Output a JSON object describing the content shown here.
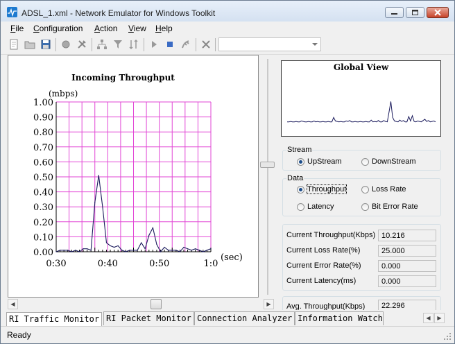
{
  "window": {
    "title": "ADSL_1.xml - Network Emulator for Windows Toolkit",
    "accent": "#1e7ad0"
  },
  "menu": [
    {
      "label": "File",
      "accel": "F",
      "rest": "ile"
    },
    {
      "label": "Configuration",
      "accel": "C",
      "rest": "onfiguration"
    },
    {
      "label": "Action",
      "accel": "A",
      "rest": "ction"
    },
    {
      "label": "View",
      "accel": "V",
      "rest": "iew"
    },
    {
      "label": "Help",
      "accel": "H",
      "rest": "elp"
    }
  ],
  "toolbar": {
    "icons": [
      "new-file-icon",
      "open-folder-icon",
      "save-disk-icon",
      "record-icon",
      "tools-icon",
      "network-icon",
      "filter-icon",
      "sort-icon",
      "play-icon",
      "stop-icon",
      "capture-icon",
      "disconnect-icon"
    ],
    "combo_value": ""
  },
  "chart_data": {
    "type": "line",
    "title": "Incoming Throughput",
    "ylabel": "(mbps)",
    "xlabel": "(sec)",
    "ylim": [
      0,
      1.0
    ],
    "y_ticks": [
      "0.00",
      "0.10",
      "0.20",
      "0.30",
      "0.40",
      "0.50",
      "0.60",
      "0.70",
      "0.80",
      "0.90",
      "1.00"
    ],
    "x_ticks": [
      "0:30",
      "0:40",
      "0:50",
      "1:0"
    ],
    "grid": true,
    "grid_color": "#e246d6",
    "line_color": "#1a1a5c",
    "series": [
      {
        "values": [
          0.0,
          0.01,
          0.01,
          0.01,
          0.0,
          0.01,
          0.0,
          0.02,
          0.02,
          0.01,
          0.33,
          0.51,
          0.3,
          0.06,
          0.04,
          0.03,
          0.04,
          0.01,
          0.0,
          0.01,
          0.01,
          0.01,
          0.06,
          0.02,
          0.11,
          0.16,
          0.05,
          0.0,
          0.03,
          0.01,
          0.01,
          0.01,
          0.0,
          0.03,
          0.02,
          0.01,
          0.02,
          0.01,
          0.0,
          0.01,
          0.02
        ]
      }
    ]
  },
  "global_view": {
    "title": "Global View",
    "series": [
      0.02,
      0.02,
      0.03,
      0.02,
      0.02,
      0.03,
      0.02,
      0.02,
      0.04,
      0.03,
      0.02,
      0.02,
      0.03,
      0.02,
      0.02,
      0.04,
      0.02,
      0.03,
      0.02,
      0.02,
      0.03,
      0.02,
      0.02,
      0.03,
      0.02,
      0.02,
      0.12,
      0.04,
      0.03,
      0.02,
      0.03,
      0.02,
      0.02,
      0.04,
      0.03,
      0.05,
      0.02,
      0.02,
      0.03,
      0.02,
      0.02,
      0.03,
      0.02,
      0.02,
      0.03,
      0.02,
      0.02,
      0.06,
      0.02,
      0.03,
      0.02,
      0.05,
      0.02,
      0.02,
      0.05,
      0.03,
      0.02,
      0.25,
      0.48,
      0.12,
      0.04,
      0.03,
      0.02,
      0.06,
      0.03,
      0.05,
      0.02,
      0.02,
      0.14,
      0.04,
      0.16,
      0.03,
      0.02,
      0.04,
      0.03,
      0.02,
      0.05,
      0.08,
      0.03,
      0.05,
      0.02,
      0.03,
      0.04,
      0.02
    ]
  },
  "stream": {
    "title": "Stream",
    "options": [
      "UpStream",
      "DownStream"
    ],
    "selected": "UpStream"
  },
  "data_group": {
    "title": "Data",
    "options": [
      "Throughput",
      "Loss Rate",
      "Latency",
      "Bit Error Rate"
    ],
    "selected": "Throughput"
  },
  "stats": [
    {
      "label": "Current Throughput(Kbps)",
      "value": "10.216"
    },
    {
      "label": "Current Loss Rate(%)",
      "value": "25.000"
    },
    {
      "label": "Current Error Rate(%)",
      "value": "0.000"
    },
    {
      "label": "Current Latency(ms)",
      "value": "0.000"
    }
  ],
  "avg_stat": {
    "label": "Avg. Throughput(Kbps)",
    "value": "22.296"
  },
  "tabs": [
    "RI Traffic Monitor",
    "RI Packet Monitor",
    "Connection Analyzer",
    "Information Watch"
  ],
  "active_tab": "RI Traffic Monitor",
  "status": {
    "text": "Ready"
  }
}
